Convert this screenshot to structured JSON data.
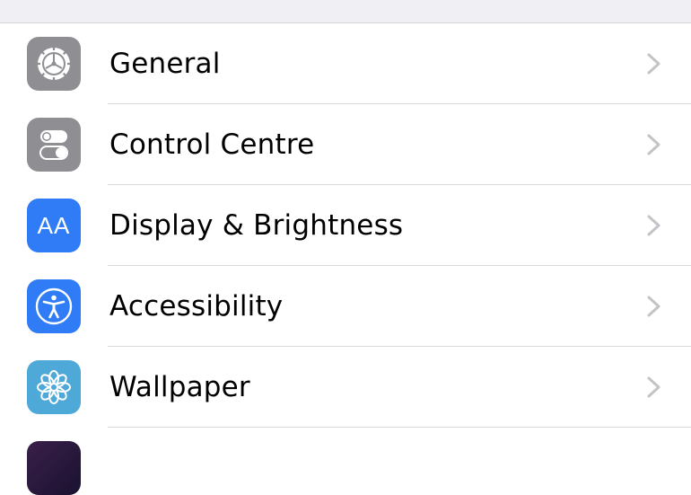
{
  "settings": {
    "items": [
      {
        "label": "General",
        "icon": "gear-icon",
        "color": "#8e8e93"
      },
      {
        "label": "Control Centre",
        "icon": "toggles-icon",
        "color": "#8e8e93"
      },
      {
        "label": "Display & Brightness",
        "icon": "text-size-icon",
        "icon_text": "AA",
        "color": "#2f7cf6"
      },
      {
        "label": "Accessibility",
        "icon": "accessibility-icon",
        "color": "#2f7cf6"
      },
      {
        "label": "Wallpaper",
        "icon": "flower-icon",
        "color": "#4ea8d8"
      }
    ],
    "partial_item": {
      "icon": "siri-icon",
      "color": "#2a1a3a"
    }
  },
  "colors": {
    "group_background": "#efeff4",
    "separator": "#d9d9dc",
    "chevron": "#c4c4c8"
  }
}
